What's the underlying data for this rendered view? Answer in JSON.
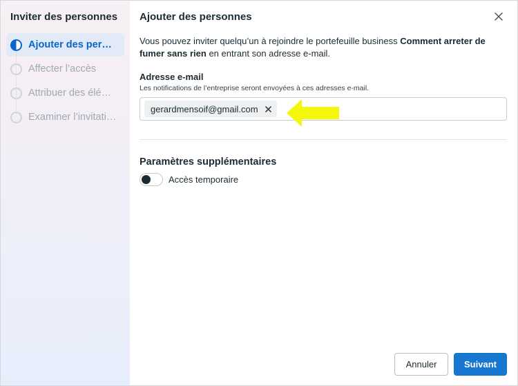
{
  "sidebar": {
    "title": "Inviter des personnes",
    "steps": [
      {
        "label": "Ajouter des personnes",
        "state": "active"
      },
      {
        "label": "Affecter l’accès",
        "state": "pending"
      },
      {
        "label": "Attribuer des éléments",
        "state": "pending"
      },
      {
        "label": "Examiner l’invitation",
        "state": "pending"
      }
    ]
  },
  "main": {
    "title": "Ajouter des personnes",
    "close_icon": "close-icon",
    "intro_prefix": "Vous pouvez inviter quelqu’un à rejoindre le portefeuille business ",
    "intro_bold": "Comment arreter de fumer sans rien",
    "intro_suffix": " en entrant son adresse e-mail.",
    "email": {
      "label": "Adresse e-mail",
      "help": "Les notifications de l’entreprise seront envoyées à ces adresses e-mail.",
      "chips": [
        "gerardmensoif@gmail.com"
      ]
    },
    "extra": {
      "title": "Paramètres supplémentaires",
      "toggle_label": "Accès temporaire",
      "toggle_on": false
    }
  },
  "footer": {
    "cancel_label": "Annuler",
    "next_label": "Suivant"
  },
  "colors": {
    "accent": "#1877d1",
    "active_step_bg": "#e2e9f7",
    "annotation_arrow": "#f5f70a"
  }
}
